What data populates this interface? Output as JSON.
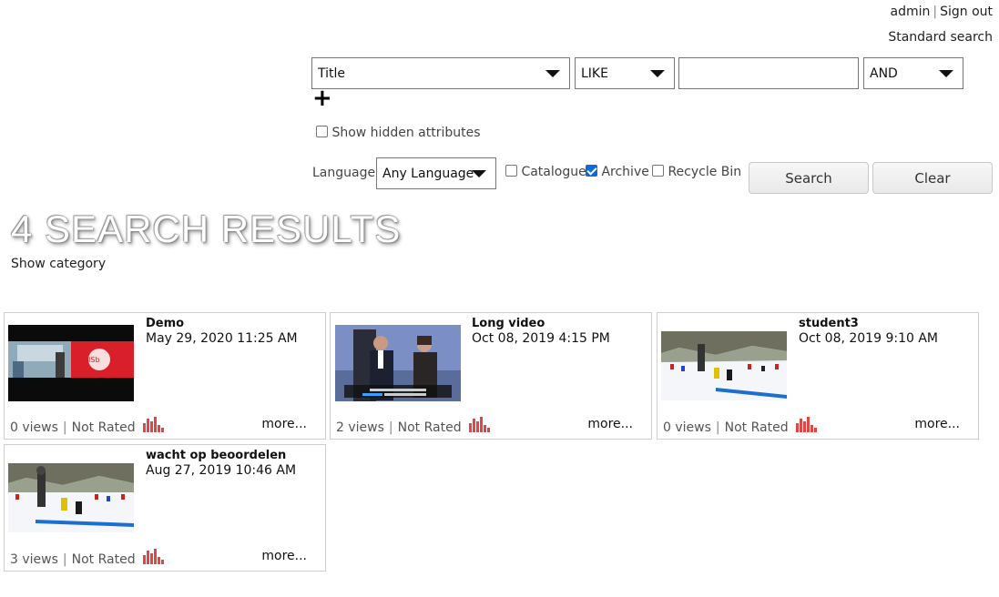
{
  "header": {
    "user": "admin",
    "separator": "|",
    "signout": "Sign out",
    "standard_search": "Standard search"
  },
  "search": {
    "field": "Title",
    "operator": "LIKE",
    "value": "",
    "conjunction": "AND",
    "add_label": "+",
    "show_hidden_label": "Show hidden attributes",
    "language_label": "Language:",
    "language_value": "Any Language",
    "options": [
      {
        "label": "Catalogue",
        "checked": false
      },
      {
        "label": "Archive",
        "checked": true
      },
      {
        "label": "Recycle Bin",
        "checked": false
      }
    ],
    "search_button": "Search",
    "clear_button": "Clear"
  },
  "results": {
    "heading": "4 SEARCH RESULTS",
    "show_category": "Show category",
    "items": [
      {
        "title": "Demo",
        "date": "May 29, 2020 11:25 AM",
        "views": "0 views",
        "rating": "Not Rated",
        "more": "more...",
        "thumb": "demo"
      },
      {
        "title": "Long video",
        "date": "Oct 08, 2019 4:15 PM",
        "views": "2 views",
        "rating": "Not Rated",
        "more": "more...",
        "thumb": "talkshow"
      },
      {
        "title": "student3",
        "date": "Oct 08, 2019 9:10 AM",
        "views": "0 views",
        "rating": "Not Rated",
        "more": "more...",
        "thumb": "ski"
      },
      {
        "title": "wacht op beoordelen",
        "date": "Aug 27, 2019 10:46 AM",
        "views": "3 views",
        "rating": "Not Rated",
        "more": "more...",
        "thumb": "ski2"
      }
    ]
  },
  "colors": {
    "accent": "#e04646",
    "checkbox": "#0a6cd6"
  }
}
